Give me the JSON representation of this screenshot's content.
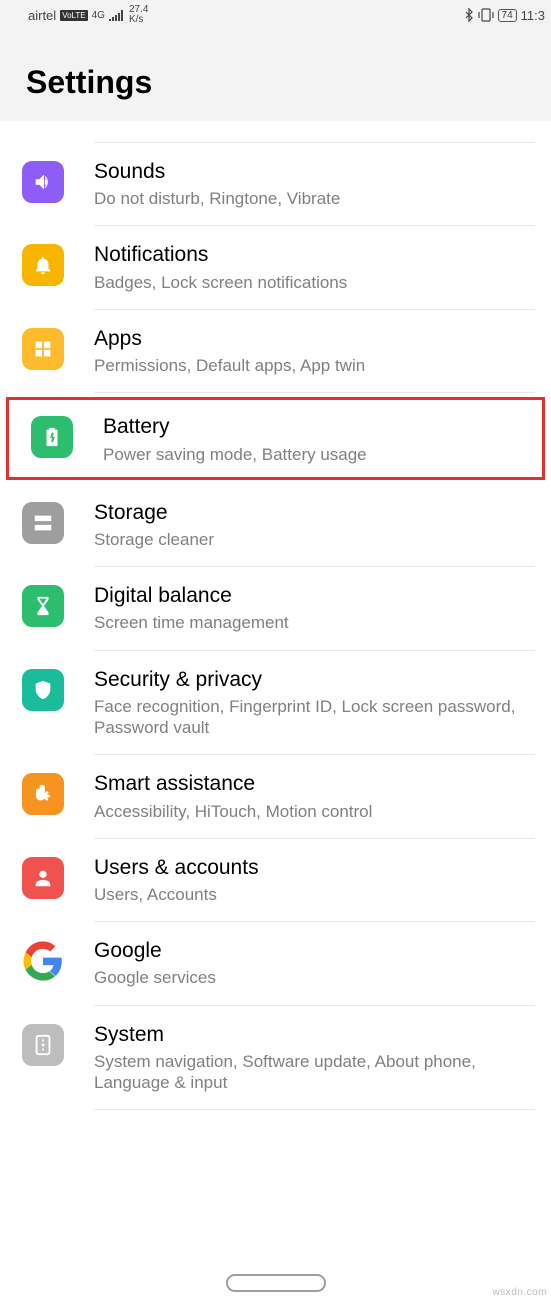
{
  "statusbar": {
    "carrier": "airtel",
    "volte": "VoLTE",
    "netgen": "4G",
    "speed_top": "27.4",
    "speed_unit": "K/s",
    "battery": "74",
    "time": "11:3"
  },
  "header": {
    "title": "Settings"
  },
  "rows": {
    "sounds": {
      "title": "Sounds",
      "subtitle": "Do not disturb, Ringtone, Vibrate"
    },
    "notifications": {
      "title": "Notifications",
      "subtitle": "Badges, Lock screen notifications"
    },
    "apps": {
      "title": "Apps",
      "subtitle": "Permissions, Default apps, App twin"
    },
    "battery": {
      "title": "Battery",
      "subtitle": "Power saving mode, Battery usage"
    },
    "storage": {
      "title": "Storage",
      "subtitle": "Storage cleaner"
    },
    "digital": {
      "title": "Digital balance",
      "subtitle": "Screen time management"
    },
    "security": {
      "title": "Security & privacy",
      "subtitle": "Face recognition, Fingerprint ID, Lock screen password, Password vault"
    },
    "smart": {
      "title": "Smart assistance",
      "subtitle": "Accessibility, HiTouch, Motion control"
    },
    "users": {
      "title": "Users & accounts",
      "subtitle": "Users, Accounts"
    },
    "google": {
      "title": "Google",
      "subtitle": "Google services"
    },
    "system": {
      "title": "System",
      "subtitle": "System navigation, Software update, About phone, Language & input"
    }
  },
  "watermark": "wsxdn.com"
}
